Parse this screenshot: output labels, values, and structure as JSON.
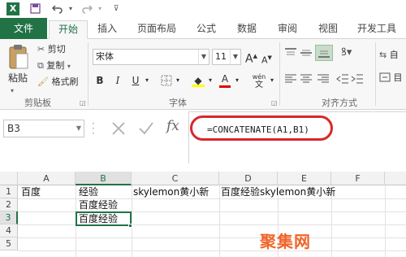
{
  "app": {
    "name": "Excel",
    "logo_letter": "X"
  },
  "qat": {
    "icons": [
      "excel-logo-icon",
      "save-icon",
      "undo-icon",
      "redo-icon",
      "customize-icon"
    ]
  },
  "tabs": [
    {
      "label": "文件",
      "state": "file"
    },
    {
      "label": "开始",
      "state": "active"
    },
    {
      "label": "插入",
      "state": "normal"
    },
    {
      "label": "页面布局",
      "state": "normal"
    },
    {
      "label": "公式",
      "state": "normal"
    },
    {
      "label": "数据",
      "state": "normal"
    },
    {
      "label": "审阅",
      "state": "normal"
    },
    {
      "label": "视图",
      "state": "normal"
    },
    {
      "label": "开发工具",
      "state": "normal"
    }
  ],
  "ribbon": {
    "clipboard": {
      "paste_label": "粘贴",
      "cut_label": "剪切",
      "copy_label": "复制",
      "format_painter_label": "格式刷",
      "group_label": "剪贴板"
    },
    "font": {
      "font_name": "宋体",
      "font_size": "11",
      "grow_label": "A",
      "shrink_label": "A",
      "bold_label": "B",
      "italic_label": "I",
      "underline_label": "U",
      "font_color_label": "A",
      "phonetic_label": "wén",
      "group_label": "字体"
    },
    "alignment": {
      "wrap_label": "自",
      "group_label": "对齐方式"
    }
  },
  "formula_bar": {
    "name_box": "B3",
    "formula": "=CONCATENATE(A1,B1)",
    "fx_label": "fx"
  },
  "sheet": {
    "columns": [
      "A",
      "B",
      "C",
      "D",
      "E",
      "F"
    ],
    "selected_column": "B",
    "rows": [
      "1",
      "2",
      "3",
      "4",
      "5"
    ],
    "selected_row": "3",
    "cells": {
      "A1": "百度",
      "B1": "经验",
      "C1": "skylemon黄小新",
      "D1": "百度经验skylemon黄小新",
      "B2": "百度经验",
      "B3": "百度经验"
    }
  },
  "watermark": {
    "text": "聚集网"
  },
  "colors": {
    "accent": "#217346",
    "annotation": "#d8282a"
  }
}
